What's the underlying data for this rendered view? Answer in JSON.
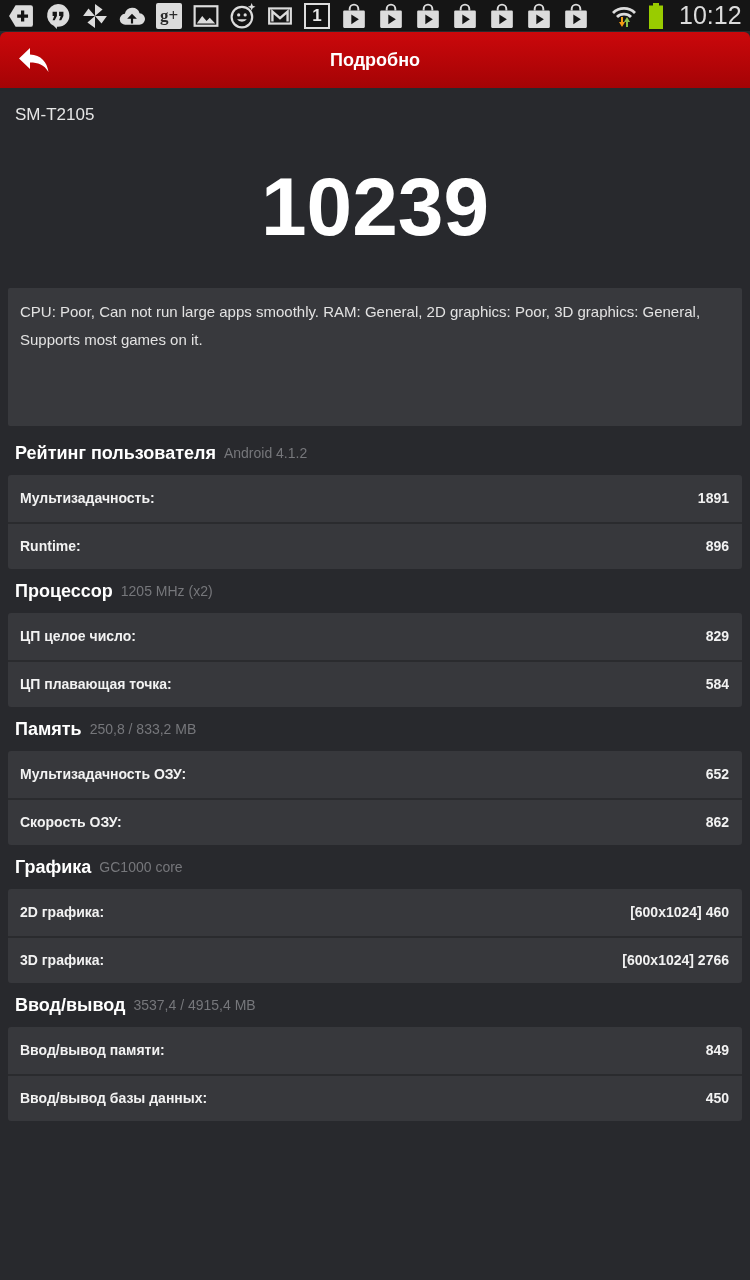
{
  "status_bar": {
    "notifications": [
      {
        "kind": "add"
      },
      {
        "kind": "quote"
      },
      {
        "kind": "pinwheel"
      },
      {
        "kind": "upload"
      },
      {
        "kind": "gplus",
        "label": "g+"
      },
      {
        "kind": "image"
      },
      {
        "kind": "smiley"
      },
      {
        "kind": "mail"
      },
      {
        "kind": "calendar",
        "label": "1"
      },
      {
        "kind": "store"
      },
      {
        "kind": "store"
      },
      {
        "kind": "store"
      },
      {
        "kind": "store"
      },
      {
        "kind": "store"
      },
      {
        "kind": "store"
      },
      {
        "kind": "store"
      }
    ],
    "time": "10:12"
  },
  "app_bar": {
    "title": "Подробно"
  },
  "device": {
    "model": "SM-T2105"
  },
  "score": "10239",
  "summary": "CPU: Poor, Can not run large apps smoothly. RAM: General, 2D graphics: Poor, 3D graphics: General, Supports most games on it.",
  "sections": [
    {
      "title": "Рейтинг пользователя",
      "subtitle": "Android 4.1.2",
      "rows": [
        {
          "label": "Мультизадачность:",
          "value": "1891"
        },
        {
          "label": "Runtime:",
          "value": "896"
        }
      ]
    },
    {
      "title": "Процессор",
      "subtitle": "1205 MHz (x2)",
      "rows": [
        {
          "label": "ЦП целое число:",
          "value": "829"
        },
        {
          "label": "ЦП плавающая точка:",
          "value": "584"
        }
      ]
    },
    {
      "title": "Память",
      "subtitle": "250,8 / 833,2 MB",
      "rows": [
        {
          "label": "Мультизадачность ОЗУ:",
          "value": "652"
        },
        {
          "label": "Скорость ОЗУ:",
          "value": "862"
        }
      ]
    },
    {
      "title": "Графика",
      "subtitle": "GC1000 core",
      "rows": [
        {
          "label": "2D графика:",
          "value": "[600x1024] 460"
        },
        {
          "label": "3D графика:",
          "value": "[600x1024] 2766"
        }
      ]
    },
    {
      "title": "Ввод/вывод",
      "subtitle": "3537,4 / 4915,4 MB",
      "rows": [
        {
          "label": "Ввод/вывод памяти:",
          "value": "849"
        },
        {
          "label": "Ввод/вывод базы данных:",
          "value": "450"
        }
      ]
    }
  ]
}
